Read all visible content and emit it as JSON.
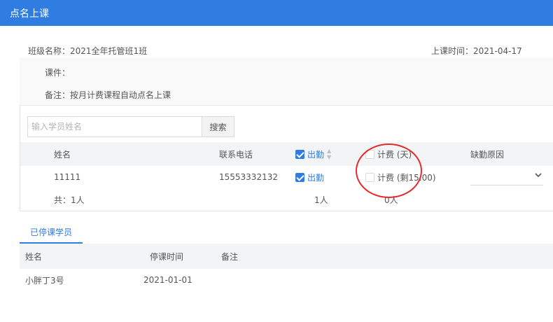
{
  "header": {
    "title": "点名上课"
  },
  "info": {
    "class_name": "班级名称：2021全年托管班1班",
    "class_time": "上课时间：2021-04-17",
    "courseware": "课件：",
    "remark": "备注：按月计费课程自动点名上课"
  },
  "search": {
    "placeholder": "输入学员姓名",
    "button": "搜索"
  },
  "table": {
    "columns": {
      "name": "姓名",
      "phone": "联系电话",
      "attend": "出勤",
      "fee": "计费 (天)",
      "absence_reason": "缺勤原因"
    },
    "rows": [
      {
        "name": "11111",
        "phone": "15553332132",
        "attend_label": "出勤",
        "attend_checked": true,
        "fee_label": "计费 (剩15.00)",
        "fee_checked": false,
        "absence_reason": ""
      }
    ],
    "totals": {
      "count": "共：1人",
      "attend": "1人",
      "fee": "0人"
    }
  },
  "stopped": {
    "tab": "已停课学员",
    "columns": {
      "name": "姓名",
      "stop_time": "停课时间",
      "remark": "备注"
    },
    "rows": [
      {
        "name": "小胖丁3号",
        "stop_time": "2021-01-01",
        "remark": ""
      }
    ]
  },
  "colors": {
    "primary": "#2f7de1",
    "annotation": "#e42a2a"
  },
  "icons": {
    "checkbox_checked": "checkbox-checked-icon",
    "sort": "sort-icon",
    "select": "chevron-down-icon"
  }
}
